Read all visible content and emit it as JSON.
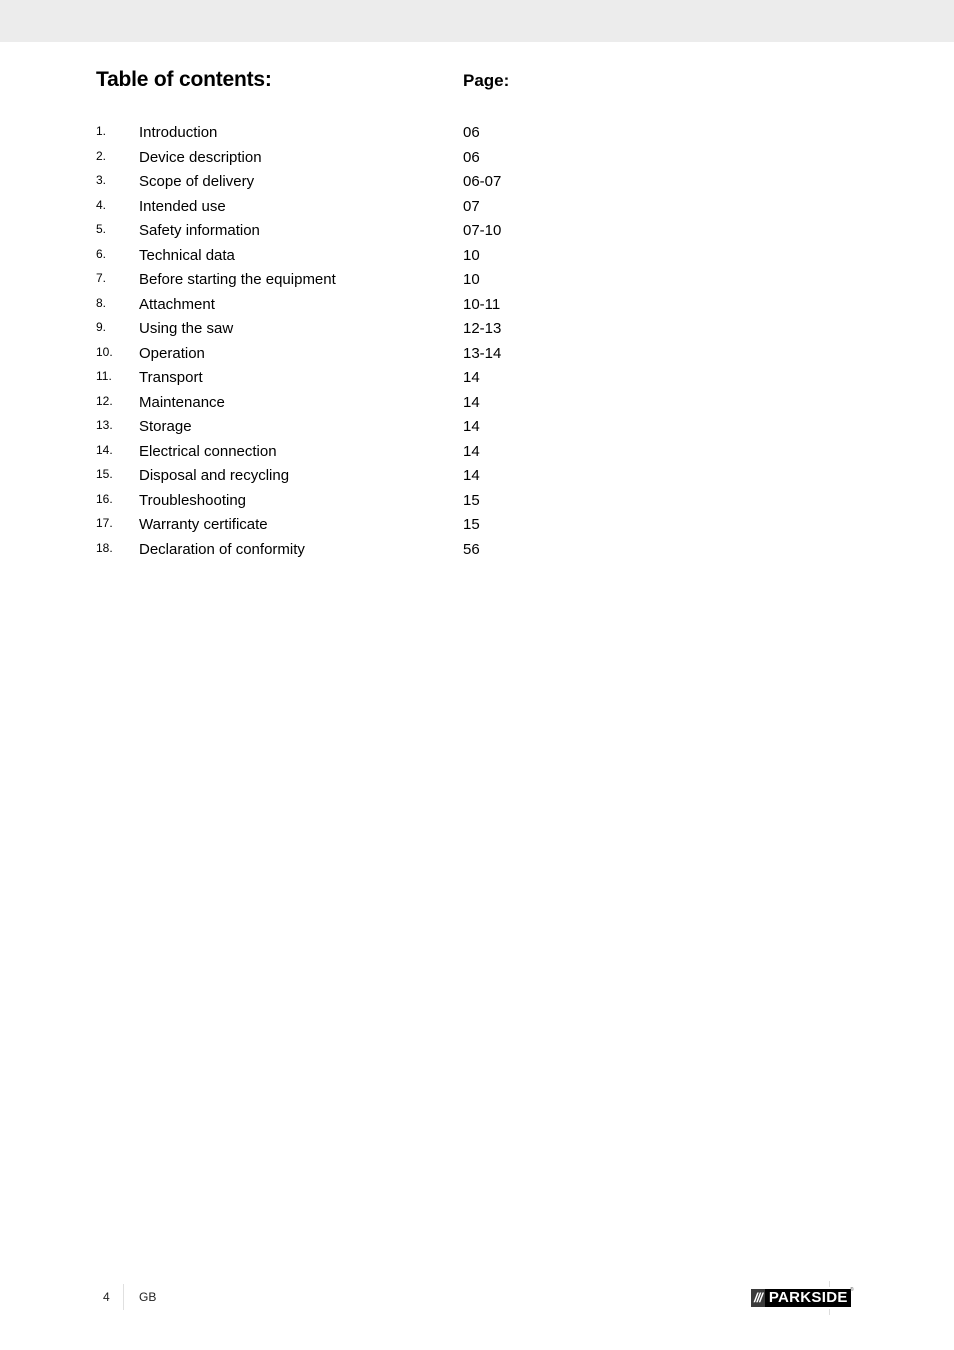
{
  "header": {
    "toc_title": "Table of contents:",
    "page_title": "Page:"
  },
  "toc": [
    {
      "num": "1.",
      "label": "Introduction",
      "page": "06"
    },
    {
      "num": "2.",
      "label": "Device description",
      "page": "06"
    },
    {
      "num": "3.",
      "label": "Scope of delivery",
      "page": "06-07"
    },
    {
      "num": "4.",
      "label": "Intended use",
      "page": "07"
    },
    {
      "num": "5.",
      "label": "Safety information",
      "page": "07-10"
    },
    {
      "num": "6.",
      "label": "Technical data",
      "page": "10"
    },
    {
      "num": "7.",
      "label": "Before starting the equipment",
      "page": "10"
    },
    {
      "num": "8.",
      "label": "Attachment",
      "page": "10-11"
    },
    {
      "num": "9.",
      "label": "Using the saw",
      "page": "12-13"
    },
    {
      "num": "10.",
      "label": "Operation",
      "page": "13-14"
    },
    {
      "num": "11.",
      "label": "Transport",
      "page": "14"
    },
    {
      "num": "12.",
      "label": "Maintenance",
      "page": "14"
    },
    {
      "num": "13.",
      "label": "Storage",
      "page": "14"
    },
    {
      "num": "14.",
      "label": "Electrical connection",
      "page": "14"
    },
    {
      "num": "15.",
      "label": "Disposal and recycling",
      "page": "14"
    },
    {
      "num": "16.",
      "label": "Troubleshooting",
      "page": "15"
    },
    {
      "num": "17.",
      "label": "Warranty certificate",
      "page": "15"
    },
    {
      "num": "18.",
      "label": "Declaration of conformity",
      "page": "56"
    }
  ],
  "footer": {
    "page_number": "4",
    "language": "GB",
    "logo": {
      "slashes": "///",
      "brand": "PARKSIDE",
      "mark": "®"
    }
  }
}
